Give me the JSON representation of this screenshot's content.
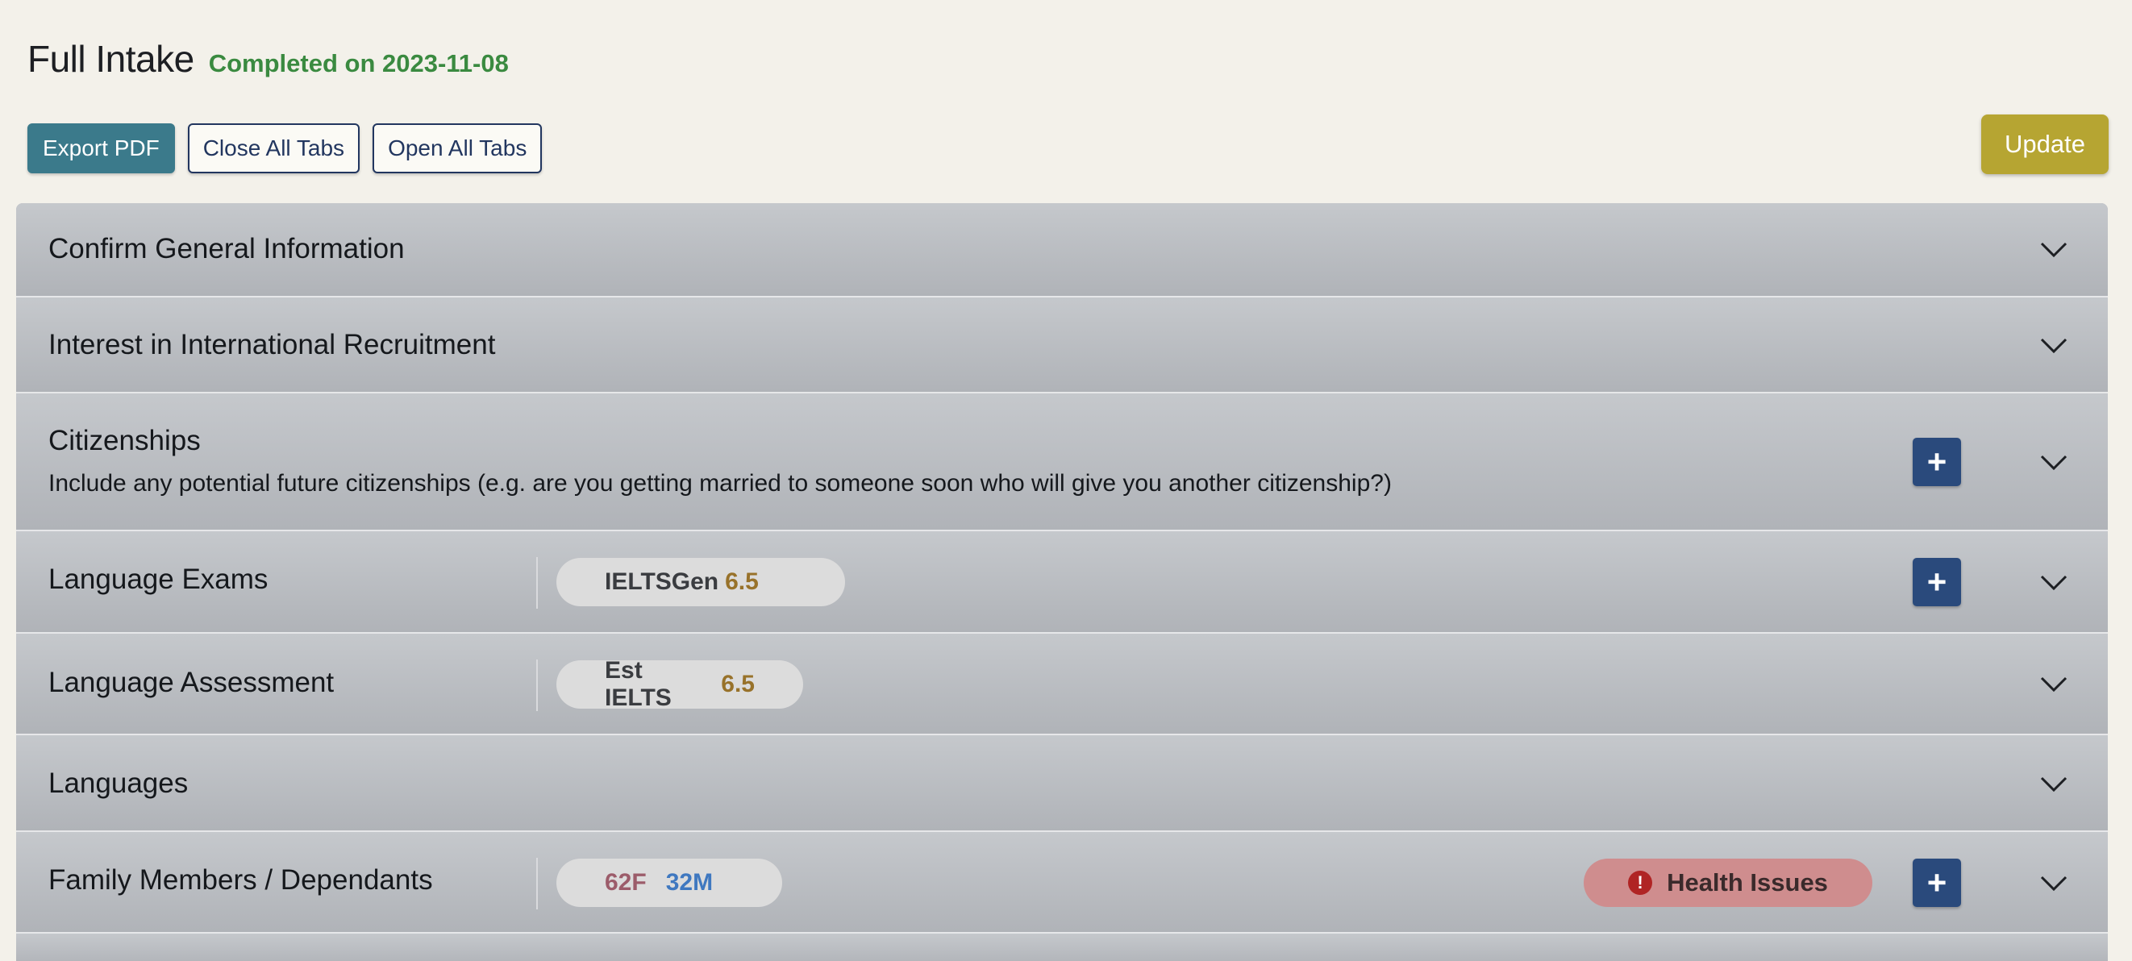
{
  "header": {
    "title": "Full Intake",
    "status": "Completed on 2023-11-08",
    "status_color": "#3a8a40"
  },
  "toolbar": {
    "export_label": "Export PDF",
    "close_all_label": "Close All Tabs",
    "open_all_label": "Open All Tabs",
    "update_label": "Update"
  },
  "sections": [
    {
      "title": "Confirm General Information"
    },
    {
      "title": "Interest in International Recruitment"
    },
    {
      "title": "Citizenships",
      "subtitle": "Include any potential future citizenships (e.g. are you getting married to someone soon who will give you another citizenship?)",
      "add_label": "+"
    },
    {
      "title": "Language Exams",
      "badge_label": "IELTSGen",
      "badge_value": "6.5",
      "add_label": "+"
    },
    {
      "title": "Language Assessment",
      "badge_label": "Est IELTS",
      "badge_value": "6.5"
    },
    {
      "title": "Languages"
    },
    {
      "title": "Family Members / Dependants",
      "member_female": "62F",
      "member_male": "32M",
      "alert_label": "Health Issues",
      "alert_icon": "!",
      "add_label": "+"
    }
  ],
  "colors": {
    "accent_teal": "#3b7a8b",
    "navy": "#2a4a7c",
    "update_gold": "#b6a532",
    "score_gold": "#98722a",
    "alert_red": "#cf8d8e"
  },
  "icons": [
    "chevron-down-icon",
    "plus-icon",
    "warning-icon"
  ]
}
